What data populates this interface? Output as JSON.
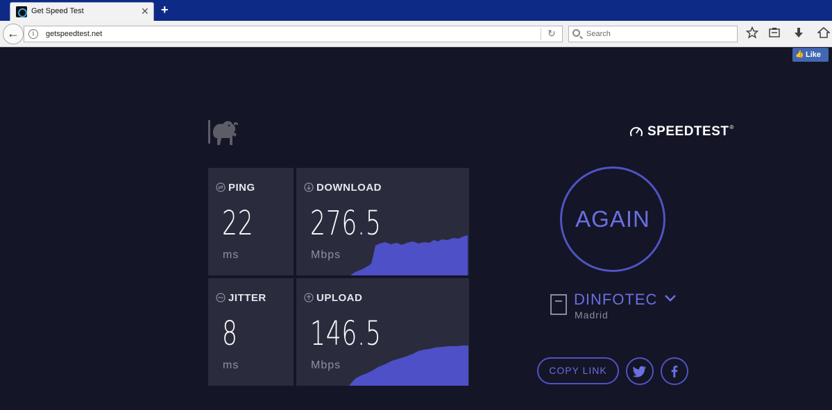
{
  "browser": {
    "tab_title": "Get Speed Test",
    "tab_close": "✕",
    "new_tab": "+",
    "back": "←",
    "url": "getspeedtest.net",
    "reload": "↻",
    "search_placeholder": "Search",
    "toolbar_icons": [
      "star-icon",
      "reading-list-icon",
      "download-icon",
      "home-icon"
    ]
  },
  "page": {
    "fb_like": "Like",
    "brand": "SPEEDTEST",
    "brand_mark": "®",
    "tiles": {
      "ping": {
        "label": "PING",
        "value": "22",
        "unit": "ms"
      },
      "download": {
        "label": "DOWNLOAD",
        "value": "276.5",
        "unit": "Mbps"
      },
      "jitter": {
        "label": "JITTER",
        "value": "8",
        "unit": "ms"
      },
      "upload": {
        "label": "UPLOAD",
        "value": "146.5",
        "unit": "Mbps"
      }
    },
    "again_button": "AGAIN",
    "server": {
      "name": "DINFOTEC",
      "location": "Madrid"
    },
    "copy_link": "COPY LINK",
    "colors": {
      "background": "#141526",
      "tile": "#2a2c3d",
      "accent": "#5053c4",
      "accent_text": "#6b6fe0"
    }
  }
}
